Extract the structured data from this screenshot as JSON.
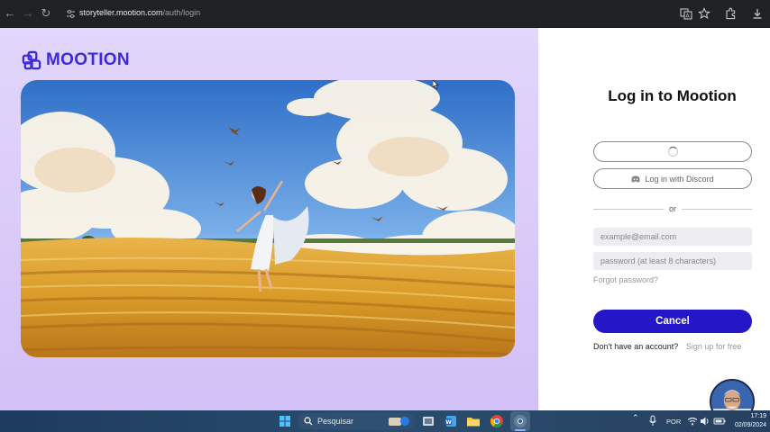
{
  "browser": {
    "url_host": "storyteller.mootion.com",
    "url_path": "/auth/login"
  },
  "brand": {
    "name": "MOOTION",
    "accent": "#3c2bd9"
  },
  "auth": {
    "title": "Log in to Mootion",
    "discord_label": "Log in with Discord",
    "divider": "or",
    "email_placeholder": "example@email.com",
    "password_placeholder": "password (at least 8 characters)",
    "forgot": "Forgot password?",
    "cancel": "Cancel",
    "no_account": "Don't have an account?",
    "signup": "Sign up for free",
    "button_color": "#2317c7"
  },
  "taskbar": {
    "search": "Pesquisar",
    "lang": "POR",
    "time": "17:19",
    "date": "02/09/2024"
  }
}
